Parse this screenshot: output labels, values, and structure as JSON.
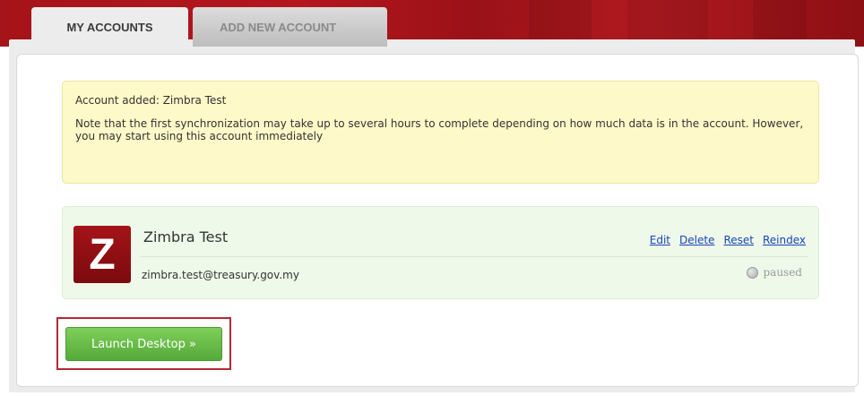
{
  "tabs": {
    "my_accounts": "MY ACCOUNTS",
    "add_new_account": "ADD NEW ACCOUNT"
  },
  "notice": {
    "title": "Account added: Zimbra Test",
    "body": "Note that the first synchronization may take up to several hours to complete depending on how much data is in the account. However, you may start using this account immediately"
  },
  "account": {
    "logo_letter": "Z",
    "name": "Zimbra Test",
    "email": "zimbra.test@treasury.gov.my",
    "status": "paused",
    "links": {
      "edit": "Edit",
      "delete": "Delete",
      "reset": "Reset",
      "reindex": "Reindex"
    }
  },
  "launch_button": "Launch Desktop »",
  "colors": {
    "brand_red": "#a5141a",
    "notice_bg": "#fdf9c8",
    "card_bg": "#eef9ea",
    "button_green": "#55a93a",
    "highlight_red": "#b22a34",
    "link_blue": "#1a44b8"
  }
}
